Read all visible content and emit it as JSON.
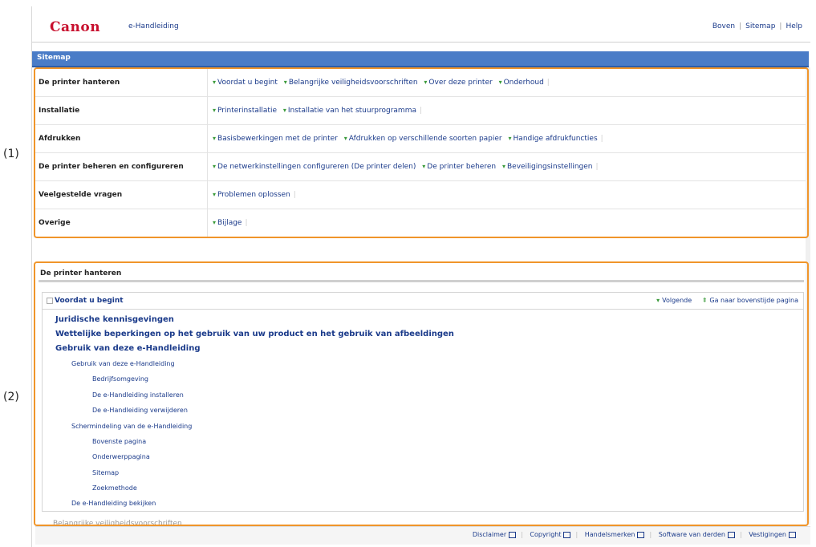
{
  "header": {
    "logo": "Canon",
    "product": "e-Handleiding",
    "links": [
      "Boven",
      "Sitemap",
      "Help"
    ]
  },
  "band": {
    "title": "Sitemap"
  },
  "sitemap": [
    {
      "cat": "De printer hanteren",
      "links": [
        "Voordat u begint",
        "Belangrijke veiligheidsvoorschriften",
        "Over deze printer",
        "Onderhoud"
      ]
    },
    {
      "cat": "Installatie",
      "links": [
        "Printerinstallatie",
        "Installatie van het stuurprogramma"
      ]
    },
    {
      "cat": "Afdrukken",
      "links": [
        "Basisbewerkingen met de printer",
        "Afdrukken op verschillende soorten papier",
        "Handige afdrukfuncties"
      ]
    },
    {
      "cat": "De printer beheren en configureren",
      "links": [
        "De netwerkinstellingen configureren (De printer delen)",
        "De printer beheren",
        "Beveiligingsinstellingen"
      ]
    },
    {
      "cat": "Veelgestelde vragen",
      "links": [
        "Problemen oplossen"
      ]
    },
    {
      "cat": "Overige",
      "links": [
        "Bijlage"
      ]
    }
  ],
  "callouts": {
    "one": "(1)",
    "two": "(2)"
  },
  "detail": {
    "section_title": "De printer hanteren",
    "sub_title": "Voordat u begint",
    "nav_next": "Volgende",
    "nav_top": "Ga naar bovenstijde pagina",
    "toc": [
      {
        "level": 1,
        "text": "Juridische kennisgevingen"
      },
      {
        "level": 1,
        "text": "Wettelijke beperkingen op het gebruik van uw product en het gebruik van afbeeldingen"
      },
      {
        "level": 1,
        "text": "Gebruik van deze e-Handleiding"
      },
      {
        "level": 2,
        "text": "Gebruik van deze e-Handleiding"
      },
      {
        "level": 3,
        "text": "Bedrijfsomgeving"
      },
      {
        "level": 3,
        "text": "De e-Handleiding installeren"
      },
      {
        "level": 3,
        "text": "De e-Handleiding verwijderen"
      },
      {
        "level": 2,
        "text": "Schermindeling van de e-Handleiding"
      },
      {
        "level": 3,
        "text": "Bovenste pagina"
      },
      {
        "level": 3,
        "text": "Onderwerppagina"
      },
      {
        "level": 3,
        "text": "Sitemap"
      },
      {
        "level": 3,
        "text": "Zoekmethode"
      },
      {
        "level": 2,
        "text": "De e-Handleiding bekijken"
      }
    ],
    "next_row": "Belangrijke veiligheidsvoorschriften"
  },
  "footer": {
    "links": [
      "Disclaimer",
      "Copyright",
      "Handelsmerken",
      "Software van derden",
      "Vestigingen"
    ]
  }
}
